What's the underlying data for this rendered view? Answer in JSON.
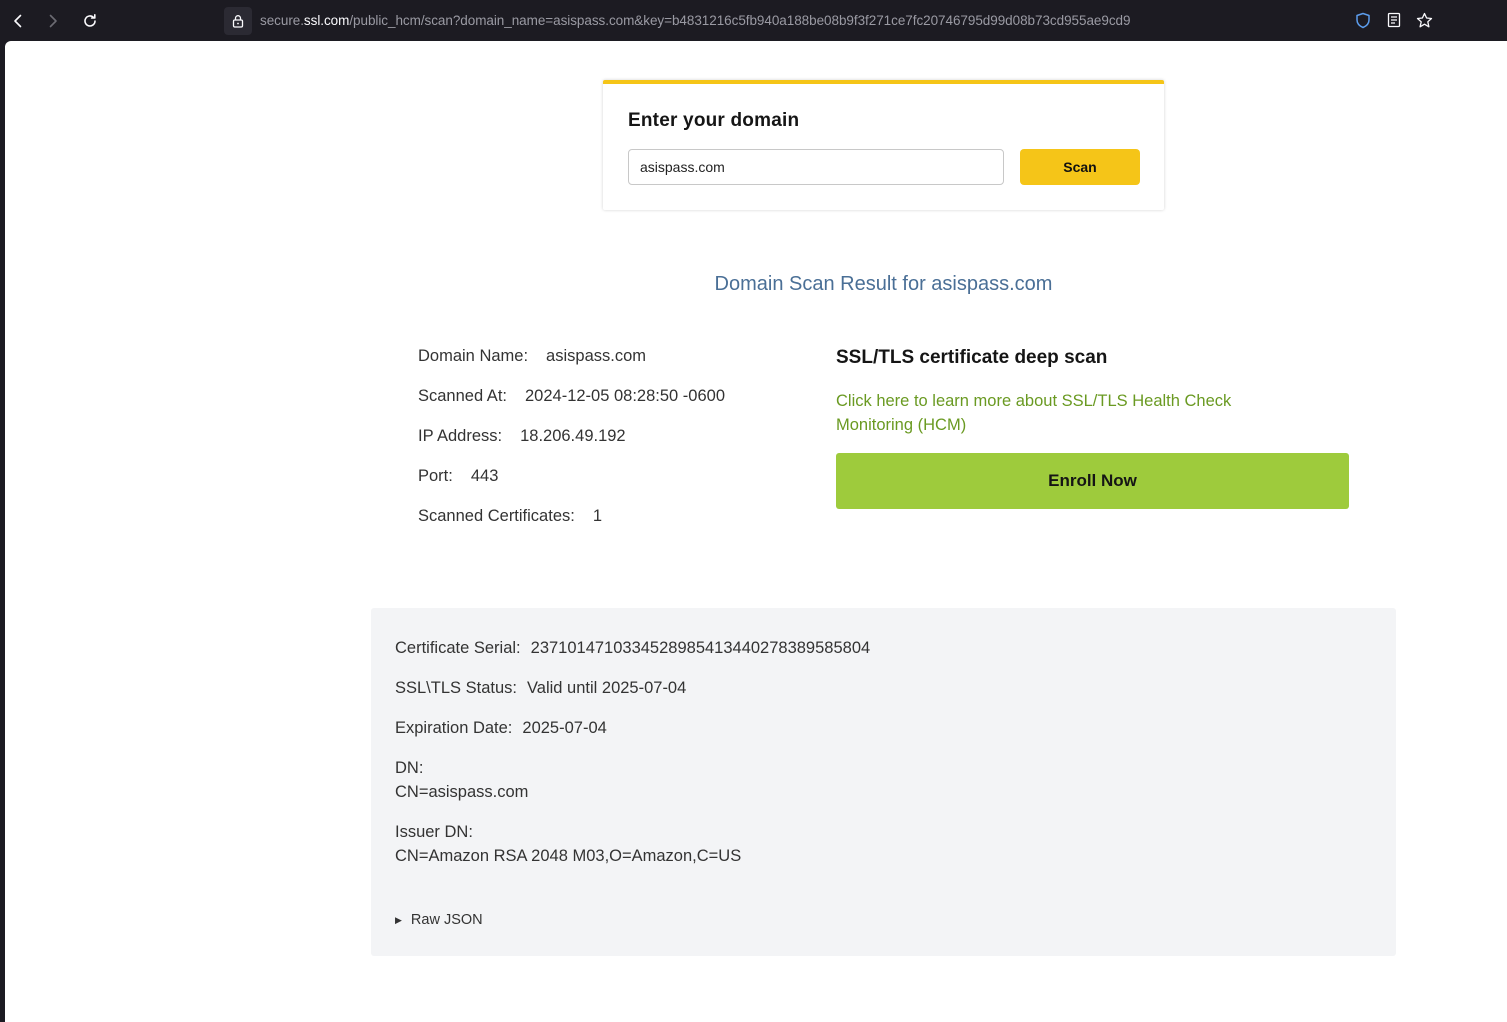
{
  "browser": {
    "url_prefix": "secure.",
    "url_host": "ssl.com",
    "url_path": "/public_hcm/scan?domain_name=asispass.com&key=b4831216c5fb940a188be08b9f3f271ce7fc20746795d99d08b73cd955ae9cd9"
  },
  "scan": {
    "title": "Enter your domain",
    "input_value": "asispass.com",
    "button_label": "Scan",
    "accent": "#f5c518"
  },
  "result": {
    "title": "Domain Scan Result for asispass.com",
    "rows": [
      {
        "label": "Domain Name:",
        "value": "asispass.com"
      },
      {
        "label": "Scanned At:",
        "value": "2024-12-05 08:28:50 -0600"
      },
      {
        "label": "IP Address:",
        "value": "18.206.49.192"
      },
      {
        "label": "Port:",
        "value": "443"
      },
      {
        "label": "Scanned Certificates:",
        "value": "1"
      }
    ]
  },
  "deep_scan": {
    "title": "SSL/TLS certificate deep scan",
    "link": "Click here to learn more about SSL/TLS Health Check Monitoring (HCM)",
    "button_label": "Enroll Now",
    "accent": "#9ecb3c"
  },
  "certificate": {
    "serial_label": "Certificate Serial:",
    "serial_value": "237101471033452898541344027838958580​4",
    "status_label": "SSL\\TLS Status:",
    "status_value": "Valid until 2025-07-04",
    "expiration_label": "Expiration Date:",
    "expiration_value": "2025-07-04",
    "dn_label": "DN:",
    "dn_value": "CN=asispass.com",
    "issuer_label": "Issuer DN:",
    "issuer_value": "CN=Amazon RSA 2048 M03,O=Amazon,C=US",
    "raw_json_label": "Raw JSON"
  }
}
